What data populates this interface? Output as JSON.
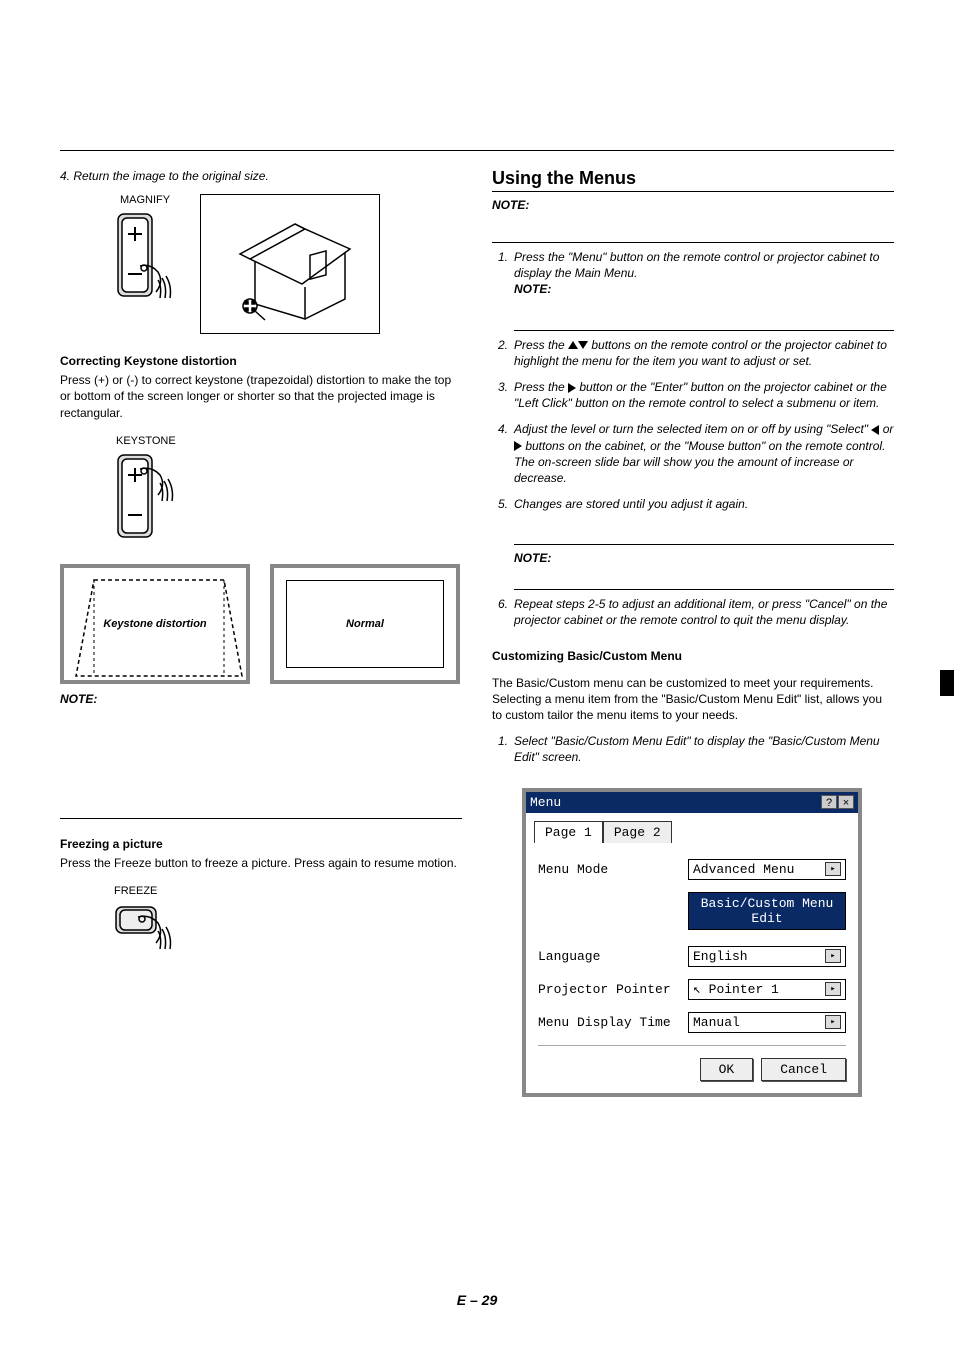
{
  "left": {
    "step4": "4.  Return the image to the original size.",
    "magnify_label": "MAGNIFY",
    "keystone_title": "Correcting Keystone distortion",
    "keystone_text": "Press (+) or (-) to correct keystone (trapezoidal) distortion to make the top or bottom of the screen longer or shorter so that the projected image is rectangular.",
    "keystone_label": "KEYSTONE",
    "diag_distortion": "Keystone distortion",
    "diag_normal": "Normal",
    "note": "NOTE:",
    "freeze_title": "Freezing a picture",
    "freeze_text": "Press the Freeze button to freeze a picture. Press again to resume motion.",
    "freeze_label": "FREEZE"
  },
  "right": {
    "title": "Using the Menus",
    "note": "NOTE:",
    "step1": "Press the \"Menu\" button on the remote control or projector cabinet to display the Main Menu.",
    "step1_note": "NOTE:",
    "step2_a": "Press the ",
    "step2_b": " buttons on the remote control or the projector cabinet to highlight the menu for the item you want to adjust or set.",
    "step3_a": "Press the ",
    "step3_b": " button or the \"Enter\" button on the projector cabinet or the \"Left Click\" button on the remote control to select a submenu or item.",
    "step4_a": "Adjust the level or turn the selected item on or off by using \"Select\" ",
    "step4_b": " or ",
    "step4_c": " buttons on the cabinet, or the \"Mouse button\" on the remote control. The on-screen slide bar will show you the amount of increase or decrease.",
    "step5": "Changes are stored until you adjust it again.",
    "mid_note": "NOTE:",
    "step6": "Repeat steps 2-5 to adjust an additional item, or press \"Cancel\" on the projector cabinet or the remote control to quit the menu display.",
    "custom_title": "Customizing Basic/Custom Menu",
    "custom_text": "The Basic/Custom menu can be customized to meet your requirements. Selecting a menu item from the \"Basic/Custom Menu Edit\" list, allows you to custom tailor the menu items to your needs.",
    "custom_step1": "Select \"Basic/Custom Menu Edit\" to display the \"Basic/Custom Menu Edit\" screen."
  },
  "menu": {
    "title": "Menu",
    "tab1": "Page 1",
    "tab2": "Page 2",
    "row_mode": "Menu Mode",
    "val_mode": "Advanced Menu",
    "edit_btn": "Basic/Custom Menu Edit",
    "row_lang": "Language",
    "val_lang": "English",
    "row_pointer": "Projector Pointer",
    "val_pointer": "Pointer 1",
    "row_time": "Menu Display Time",
    "val_time": "Manual",
    "ok": "OK",
    "cancel": "Cancel"
  },
  "page_number": "E – 29"
}
